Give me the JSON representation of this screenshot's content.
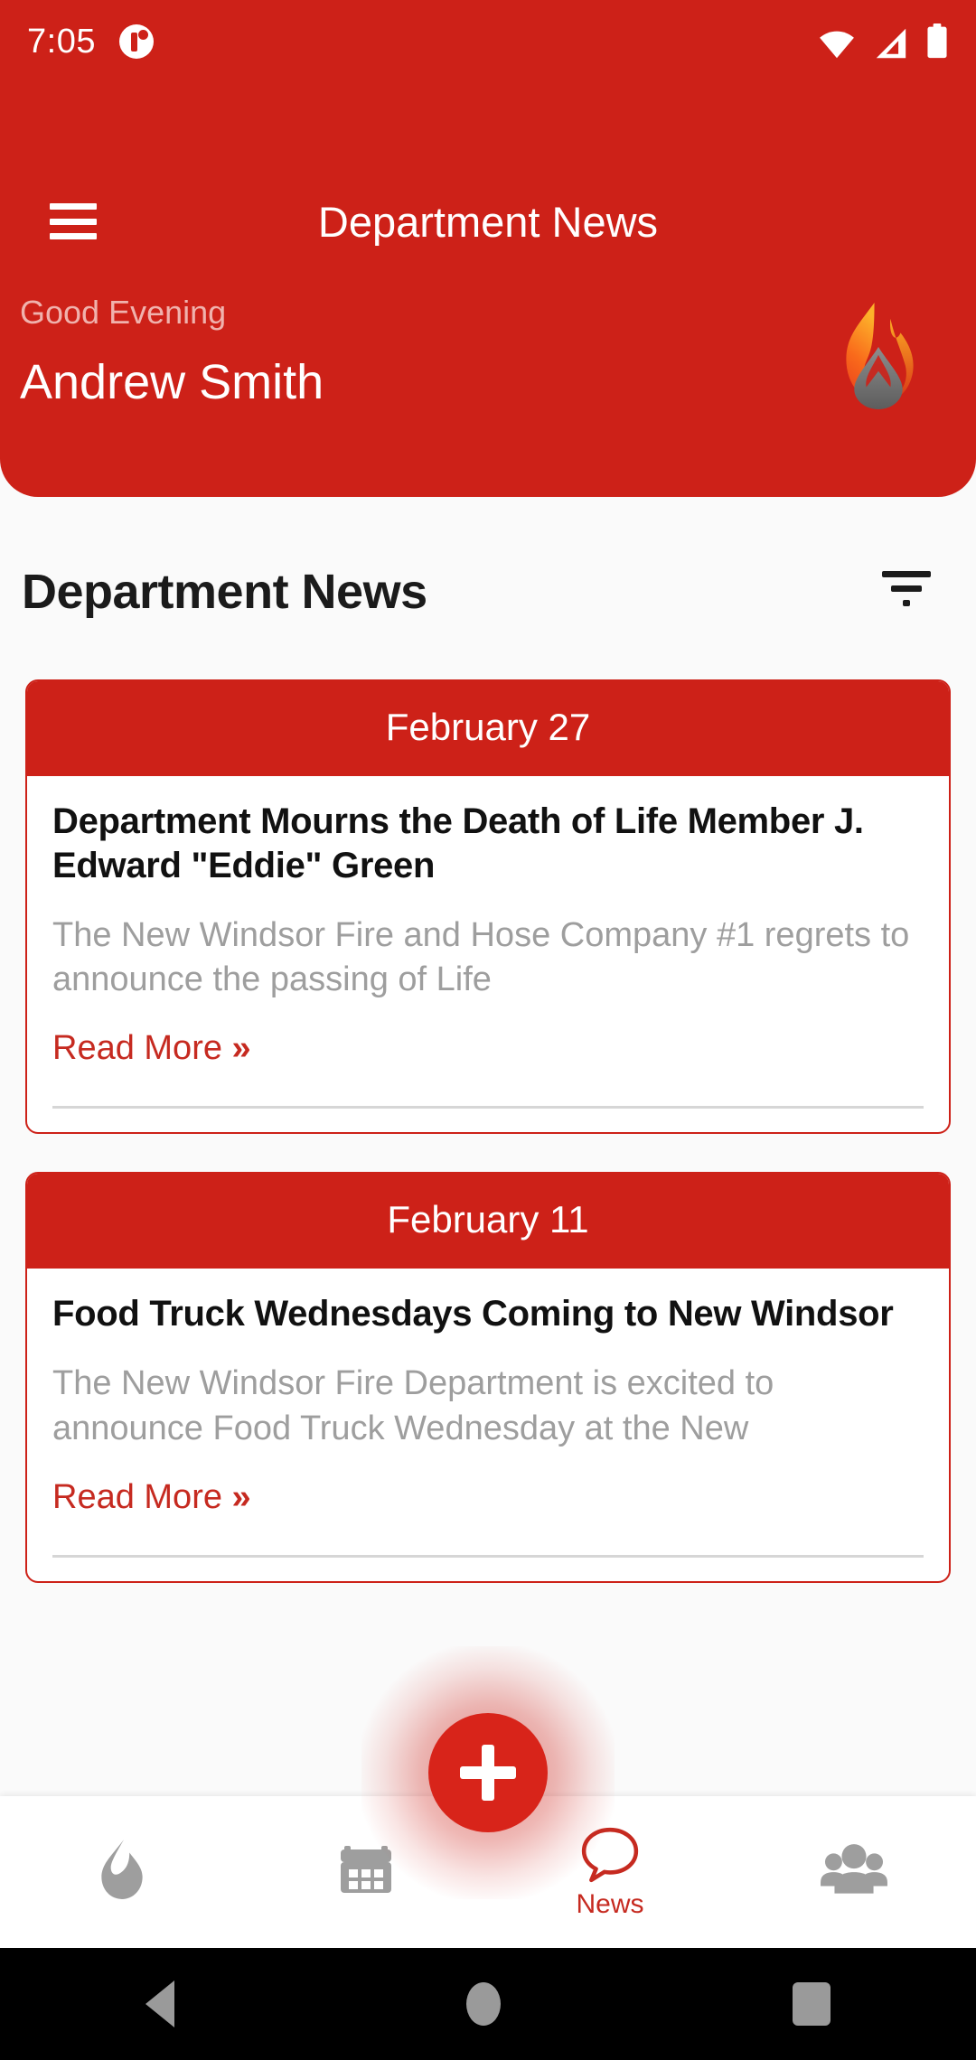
{
  "status_bar": {
    "time": "7:05",
    "notification_icon": "notification-dot-icon",
    "wifi_icon": "wifi-icon",
    "cellular_icon": "cellular-signal-icon",
    "battery_icon": "battery-full-icon"
  },
  "header": {
    "menu_icon": "hamburger-menu-icon",
    "title": "Department News",
    "greeting": "Good Evening",
    "user_name": "Andrew Smith",
    "logo_icon": "fire-flame-logo-icon",
    "background_color": "#cd2118"
  },
  "section": {
    "title": "Department News",
    "filter_icon": "filter-icon"
  },
  "news": [
    {
      "date": "February 27",
      "title": "Department Mourns the Death of Life Member J. Edward \"Eddie\" Green",
      "excerpt": "The New Windsor Fire and Hose Company #1 regrets to announce the passing of Life",
      "read_more": "Read More",
      "read_more_chevron": "»"
    },
    {
      "date": "February 11",
      "title": "Food Truck Wednesdays Coming to New Windsor",
      "excerpt": "The New Windsor Fire Department is excited to announce Food Truck Wednesday at the New",
      "read_more": "Read More",
      "read_more_chevron": "»"
    }
  ],
  "fab": {
    "icon": "plus-icon",
    "color": "#d8241a"
  },
  "bottom_nav": {
    "items": [
      {
        "icon": "flame-icon",
        "label": "",
        "active": false
      },
      {
        "icon": "calendar-icon",
        "label": "",
        "active": false
      },
      {
        "icon": "chat-bubble-icon",
        "label": "News",
        "active": true
      },
      {
        "icon": "group-people-icon",
        "label": "",
        "active": false
      }
    ],
    "active_color": "#c62a20",
    "inactive_color": "#9e9e9e"
  },
  "android_nav": {
    "back_icon": "back-triangle-icon",
    "home_icon": "home-circle-icon",
    "recents_icon": "recents-square-icon"
  }
}
